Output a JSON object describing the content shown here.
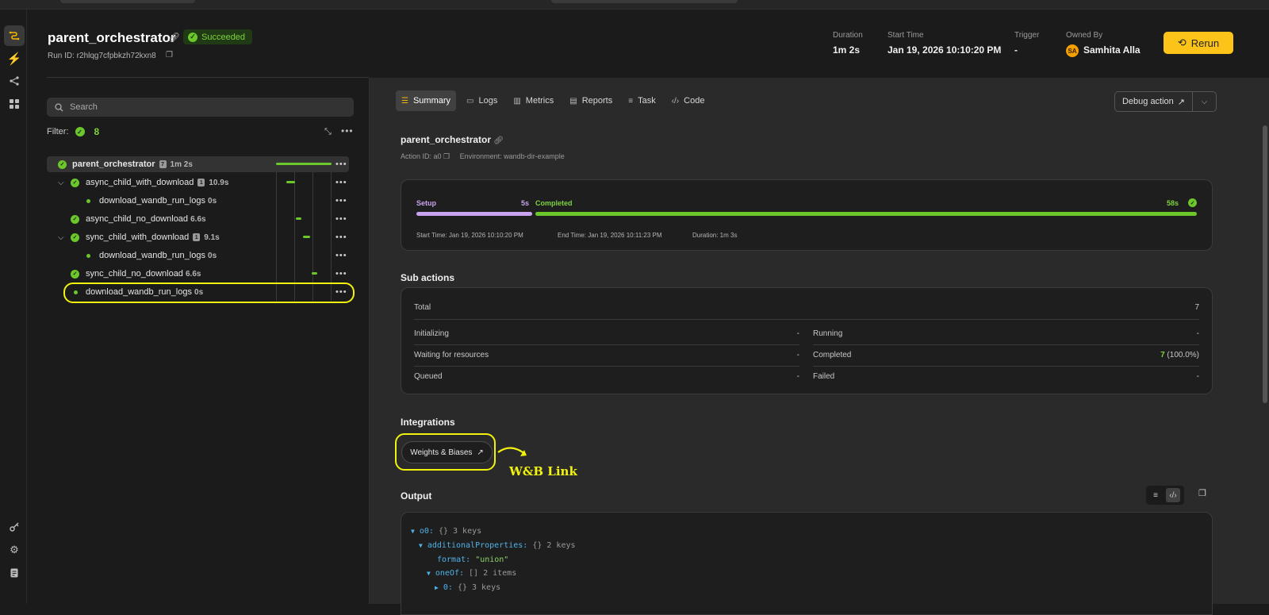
{
  "header": {
    "title": "parent_orchestrator",
    "status": "Succeeded",
    "run_id_label": "Run ID: r2hlqg7cfpbkzh72kxn8",
    "meta": [
      {
        "label": "Duration",
        "value": "1m 2s"
      },
      {
        "label": "Start Time",
        "value": "Jan 19, 2026 10:10:20 PM"
      },
      {
        "label": "Trigger",
        "value": "-"
      },
      {
        "label": "Owned By",
        "value": "Samhita Alla"
      }
    ],
    "owner_initials": "SA",
    "rerun_label": "Rerun"
  },
  "left": {
    "search_placeholder": "Search",
    "filter_label": "Filter:",
    "filter_count": "8",
    "tree": [
      {
        "name": "parent_orchestrator",
        "count": "7",
        "duration": "1m 2s"
      },
      {
        "name": "async_child_with_download",
        "count": "1",
        "duration": "10.9s"
      },
      {
        "name": "download_wandb_run_logs",
        "duration": "0s"
      },
      {
        "name": "async_child_no_download",
        "duration": "6.6s"
      },
      {
        "name": "sync_child_with_download",
        "count": "1",
        "duration": "9.1s"
      },
      {
        "name": "download_wandb_run_logs",
        "duration": "0s"
      },
      {
        "name": "sync_child_no_download",
        "duration": "6.6s"
      },
      {
        "name": "download_wandb_run_logs",
        "duration": "0s"
      }
    ]
  },
  "tabs": [
    {
      "label": "Summary",
      "icon": "summary-icon"
    },
    {
      "label": "Logs",
      "icon": "logs-icon"
    },
    {
      "label": "Metrics",
      "icon": "metrics-icon"
    },
    {
      "label": "Reports",
      "icon": "reports-icon"
    },
    {
      "label": "Task",
      "icon": "task-icon"
    },
    {
      "label": "Code",
      "icon": "code-icon"
    }
  ],
  "debug_label": "Debug action",
  "summary": {
    "action_name": "parent_orchestrator",
    "action_id": "Action ID: a0",
    "environment": "Environment: wandb-dir-example",
    "timeline": {
      "setup_label": "Setup",
      "setup_duration": "5s",
      "completed_label": "Completed",
      "completed_duration": "58s",
      "start": "Start Time: Jan 19, 2026 10:10:20 PM",
      "end": "End Time: Jan 19, 2026 10:11:23 PM",
      "duration": "Duration: 1m 3s"
    }
  },
  "sub_actions": {
    "title": "Sub actions",
    "total_label": "Total",
    "total_value": "7",
    "left": [
      {
        "label": "Initializing",
        "value": "-"
      },
      {
        "label": "Waiting for resources",
        "value": "-"
      },
      {
        "label": "Queued",
        "value": "-"
      }
    ],
    "right": [
      {
        "label": "Running",
        "value": "-"
      },
      {
        "label": "Completed",
        "value": "7",
        "pct": "(100.0%)"
      },
      {
        "label": "Failed",
        "value": "-"
      }
    ]
  },
  "integrations": {
    "title": "Integrations",
    "wandb_label": "Weights & Biases",
    "annotation": "W&B Link"
  },
  "output": {
    "title": "Output",
    "lines": [
      {
        "key": "o0:",
        "meta": "{}  3 keys"
      },
      {
        "key": "additionalProperties:",
        "meta": "{}  2 keys"
      },
      {
        "key": "format:",
        "value": "\"union\""
      },
      {
        "key": "oneOf:",
        "meta": "[]  2 items"
      },
      {
        "key": "0:",
        "meta": "{}  3 keys"
      }
    ]
  },
  "colors": {
    "accent": "#fcc419",
    "success": "#6cc72a",
    "setup": "#c9a3f0",
    "highlight": "#f2f20f"
  }
}
